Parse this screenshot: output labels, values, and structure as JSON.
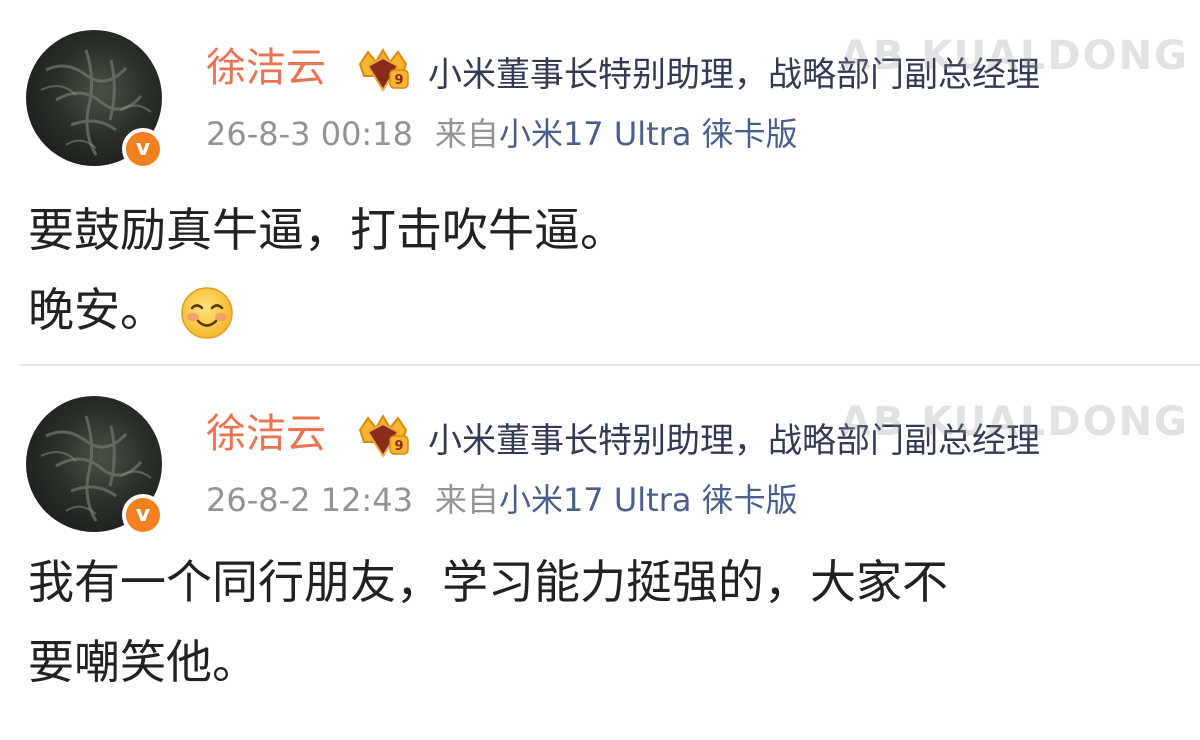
{
  "watermark": "AB KUALDONG",
  "colors": {
    "username": "#eb7350",
    "verified_badge": "#f3801e",
    "device_link": "#4a5f8c",
    "meta_gray": "#939393"
  },
  "posts": [
    {
      "username": "徐洁云",
      "member_icon": "crown-member-icon",
      "user_title": "小米董事长特别助理，战略部门副总经理",
      "time": "26-8-3 00:18",
      "source_prefix": "来自",
      "device": "小米17 Ultra 徕卡版",
      "content_lines": [
        "要鼓励真牛逼，打击吹牛逼。",
        "晚安。"
      ],
      "emoji": "smile-emoji"
    },
    {
      "username": "徐洁云",
      "member_icon": "crown-member-icon",
      "user_title": "小米董事长特别助理，战略部门副总经理",
      "time": "26-8-2 12:43",
      "source_prefix": "来自",
      "device": "小米17 Ultra 徕卡版",
      "content_lines": [
        "我有一个同行朋友，学习能力挺强的，大家不",
        "要嘲笑他。"
      ]
    }
  ]
}
